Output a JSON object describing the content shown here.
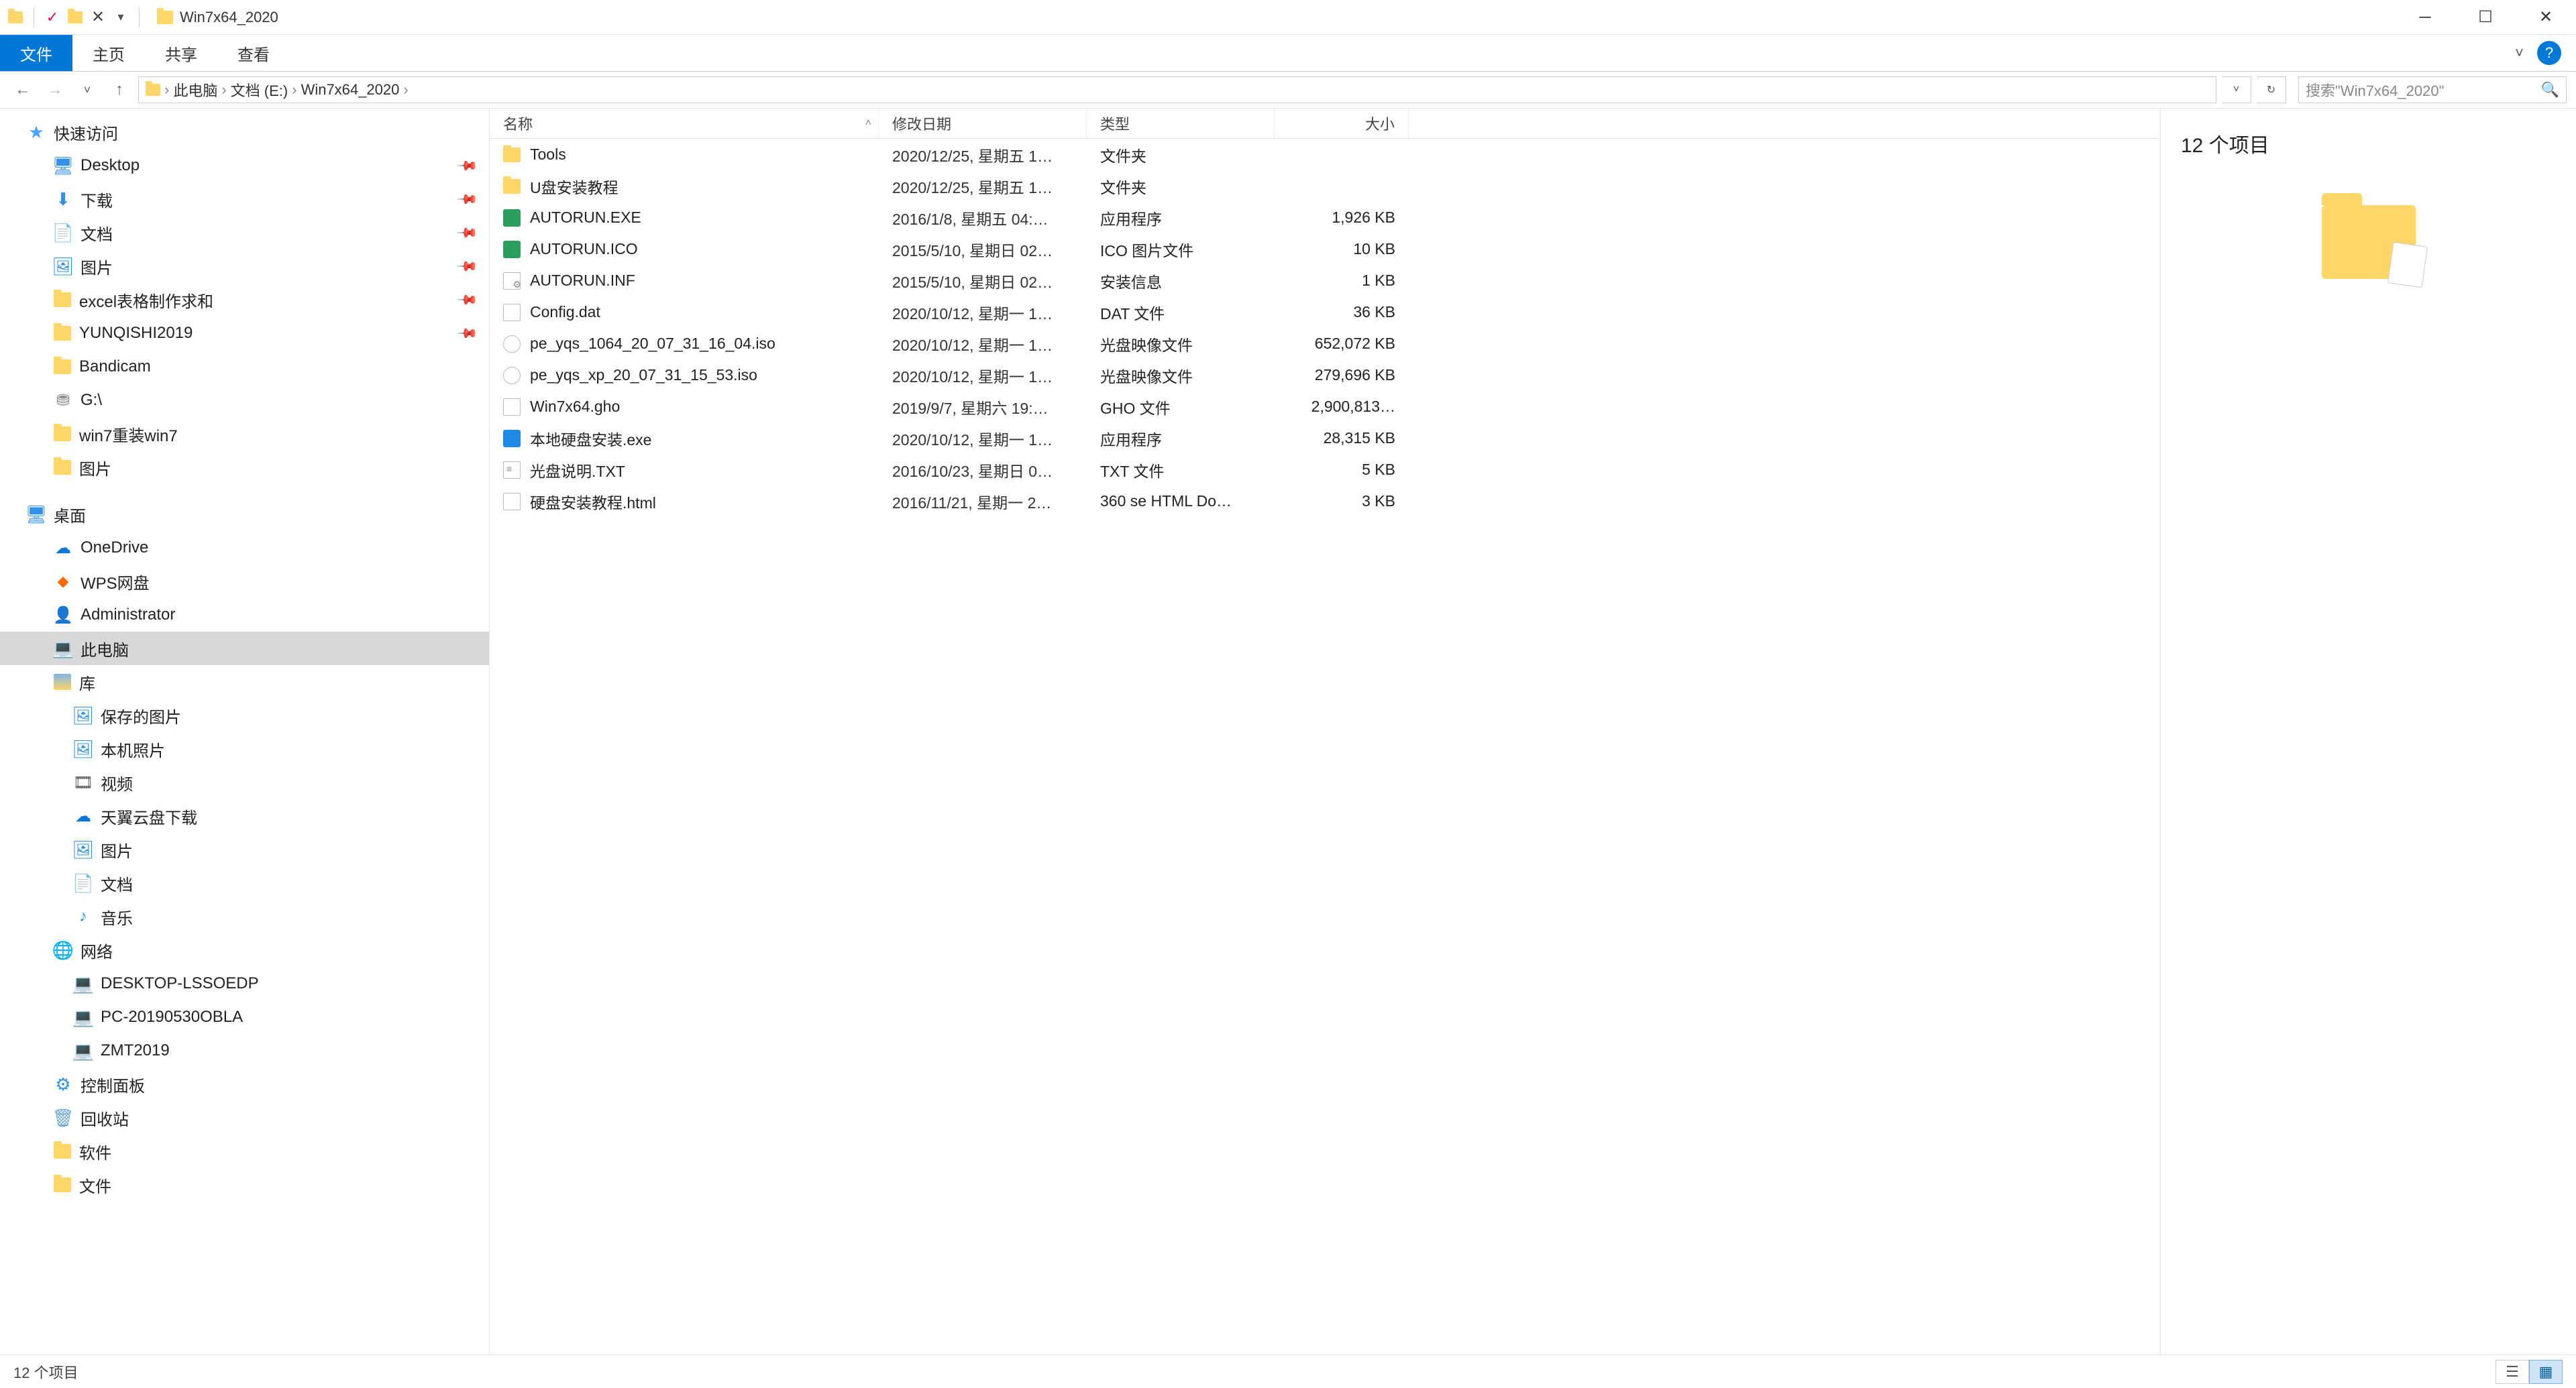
{
  "title": "Win7x64_2020",
  "ribbon": {
    "file": "文件",
    "home": "主页",
    "share": "共享",
    "view": "查看"
  },
  "breadcrumbs": [
    "此电脑",
    "文档 (E:)",
    "Win7x64_2020"
  ],
  "search_placeholder": "搜索\"Win7x64_2020\"",
  "columns": {
    "name": "名称",
    "date": "修改日期",
    "type": "类型",
    "size": "大小"
  },
  "sidebar": {
    "quick": "快速访问",
    "quick_items": [
      {
        "label": "Desktop",
        "icon": "desktop",
        "pinned": true
      },
      {
        "label": "下载",
        "icon": "dl",
        "pinned": true
      },
      {
        "label": "文档",
        "icon": "doc",
        "pinned": true
      },
      {
        "label": "图片",
        "icon": "pic",
        "pinned": true
      },
      {
        "label": "excel表格制作求和",
        "icon": "folder",
        "pinned": true
      },
      {
        "label": "YUNQISHI2019",
        "icon": "folder",
        "pinned": true
      },
      {
        "label": "Bandicam",
        "icon": "folder",
        "pinned": false
      },
      {
        "label": "G:\\",
        "icon": "drive",
        "pinned": false
      },
      {
        "label": "win7重装win7",
        "icon": "folder",
        "pinned": false
      },
      {
        "label": "图片",
        "icon": "folder",
        "pinned": false
      }
    ],
    "desktop": "桌面",
    "desktop_items": [
      {
        "label": "OneDrive",
        "icon": "cloud"
      },
      {
        "label": "WPS网盘",
        "icon": "wps"
      },
      {
        "label": "Administrator",
        "icon": "user"
      },
      {
        "label": "此电脑",
        "icon": "pc",
        "selected": true
      },
      {
        "label": "库",
        "icon": "lib"
      }
    ],
    "lib_items": [
      {
        "label": "保存的图片",
        "icon": "pic"
      },
      {
        "label": "本机照片",
        "icon": "pic"
      },
      {
        "label": "视频",
        "icon": "vid"
      },
      {
        "label": "天翼云盘下载",
        "icon": "cloud"
      },
      {
        "label": "图片",
        "icon": "pic"
      },
      {
        "label": "文档",
        "icon": "doc"
      },
      {
        "label": "音乐",
        "icon": "music"
      }
    ],
    "network": "网络",
    "network_items": [
      {
        "label": "DESKTOP-LSSOEDP",
        "icon": "pc"
      },
      {
        "label": "PC-20190530OBLA",
        "icon": "pc"
      },
      {
        "label": "ZMT2019",
        "icon": "pc"
      }
    ],
    "tail_items": [
      {
        "label": "控制面板",
        "icon": "cp"
      },
      {
        "label": "回收站",
        "icon": "bin"
      },
      {
        "label": "软件",
        "icon": "folder"
      },
      {
        "label": "文件",
        "icon": "folder"
      }
    ]
  },
  "files": [
    {
      "name": "Tools",
      "date": "2020/12/25, 星期五 1…",
      "type": "文件夹",
      "size": "",
      "icon": "folder"
    },
    {
      "name": "U盘安装教程",
      "date": "2020/12/25, 星期五 1…",
      "type": "文件夹",
      "size": "",
      "icon": "folder"
    },
    {
      "name": "AUTORUN.EXE",
      "date": "2016/1/8, 星期五 04:…",
      "type": "应用程序",
      "size": "1,926 KB",
      "icon": "exe"
    },
    {
      "name": "AUTORUN.ICO",
      "date": "2015/5/10, 星期日 02…",
      "type": "ICO 图片文件",
      "size": "10 KB",
      "icon": "icoimg"
    },
    {
      "name": "AUTORUN.INF",
      "date": "2015/5/10, 星期日 02…",
      "type": "安装信息",
      "size": "1 KB",
      "icon": "inf"
    },
    {
      "name": "Config.dat",
      "date": "2020/10/12, 星期一 1…",
      "type": "DAT 文件",
      "size": "36 KB",
      "icon": "dat"
    },
    {
      "name": "pe_yqs_1064_20_07_31_16_04.iso",
      "date": "2020/10/12, 星期一 1…",
      "type": "光盘映像文件",
      "size": "652,072 KB",
      "icon": "iso"
    },
    {
      "name": "pe_yqs_xp_20_07_31_15_53.iso",
      "date": "2020/10/12, 星期一 1…",
      "type": "光盘映像文件",
      "size": "279,696 KB",
      "icon": "iso"
    },
    {
      "name": "Win7x64.gho",
      "date": "2019/9/7, 星期六 19:…",
      "type": "GHO 文件",
      "size": "2,900,813…",
      "icon": "gho"
    },
    {
      "name": "本地硬盘安装.exe",
      "date": "2020/10/12, 星期一 1…",
      "type": "应用程序",
      "size": "28,315 KB",
      "icon": "blue"
    },
    {
      "name": "光盘说明.TXT",
      "date": "2016/10/23, 星期日 0…",
      "type": "TXT 文件",
      "size": "5 KB",
      "icon": "txt"
    },
    {
      "name": "硬盘安装教程.html",
      "date": "2016/11/21, 星期一 2…",
      "type": "360 se HTML Do…",
      "size": "3 KB",
      "icon": "html"
    }
  ],
  "preview": {
    "title": "12 个项目"
  },
  "status": "12 个项目"
}
